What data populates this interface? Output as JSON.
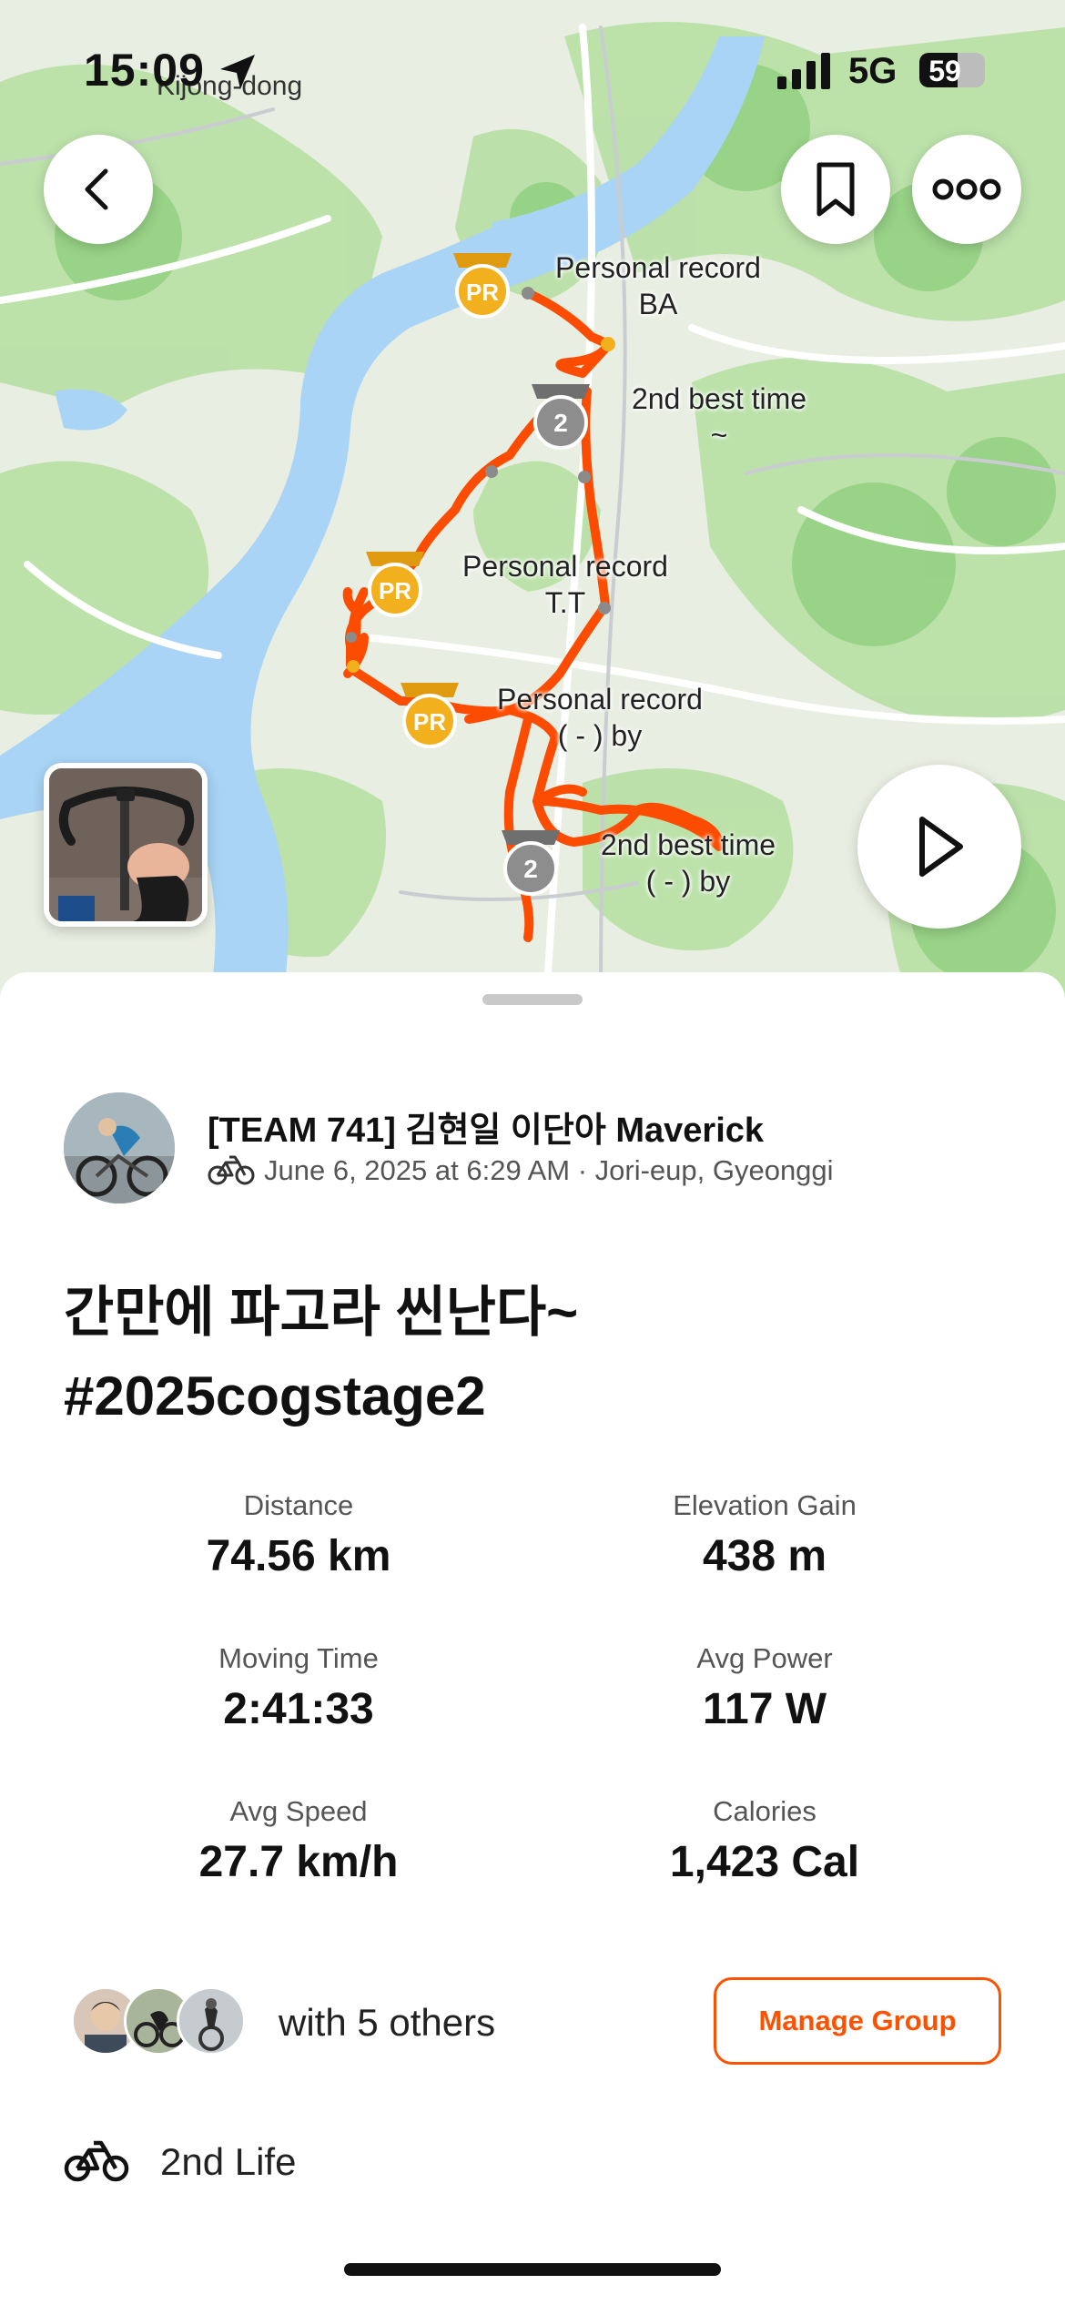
{
  "status_bar": {
    "time": "15:09",
    "place": "Kijong-dong",
    "network": "5G",
    "battery": "59",
    "battery_level": 0.59,
    "icons": [
      "location-arrow-icon",
      "signal-bars-icon",
      "battery-icon"
    ]
  },
  "map": {
    "segments": [
      {
        "line1": "Personal record",
        "line2": "BA",
        "badge": "PR"
      },
      {
        "line1": "2nd best time",
        "line2": "~",
        "badge": "2"
      },
      {
        "line1": "Personal record",
        "line2": "T.T",
        "badge": "PR"
      },
      {
        "line1": "Personal record",
        "line2": "(      -     ) by",
        "badge": "PR"
      },
      {
        "line1": "2nd best time",
        "line2": "(     -     ) by",
        "badge": "2"
      }
    ],
    "colors": {
      "route": "#fc4c02",
      "pr_badge": "#f2b01e",
      "second_badge": "#8d8d8d",
      "water": "#a9d4f5",
      "land": "#e9eee2",
      "forest": "#b7dfa5"
    },
    "buttons": [
      "back-icon",
      "bookmark-icon",
      "more-icon",
      "play-icon"
    ]
  },
  "activity": {
    "athlete": "[TEAM 741] 김현일 이단아 Maverick",
    "meta": "June 6, 2025 at 6:29 AM · Jori-eup, Gyeonggi",
    "sport_icon": "bike-icon",
    "title": "간만에 파고라 씬난다~ #2025cogstage2"
  },
  "stats": [
    {
      "label": "Distance",
      "value": "74.56 km"
    },
    {
      "label": "Elevation Gain",
      "value": "438 m"
    },
    {
      "label": "Moving Time",
      "value": "2:41:33"
    },
    {
      "label": "Avg Power",
      "value": "117 W"
    },
    {
      "label": "Avg Speed",
      "value": "27.7 km/h"
    },
    {
      "label": "Calories",
      "value": "1,423 Cal"
    }
  ],
  "group": {
    "text": "with 5 others",
    "manage_label": "Manage Group"
  },
  "gear": {
    "name": "2nd Life",
    "icon": "bike-icon"
  },
  "theme": {
    "accent": "#fc5200"
  }
}
